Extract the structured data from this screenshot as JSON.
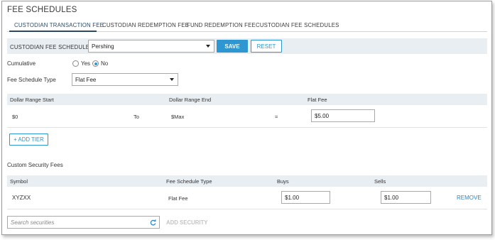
{
  "page": {
    "title": "FEE SCHEDULES"
  },
  "tabs": [
    {
      "label": "CUSTODIAN TRANSACTION FEE",
      "active": true
    },
    {
      "label": "CUSTODIAN REDEMPTION FEE",
      "active": false
    },
    {
      "label": "FUND REDEMPTION FEE",
      "active": false
    },
    {
      "label": "CUSTODIAN FEE SCHEDULES",
      "active": false
    }
  ],
  "schedule_bar": {
    "label": "CUSTODIAN FEE SCHEDULE",
    "selected": "Pershing",
    "save_label": "SAVE",
    "reset_label": "RESET"
  },
  "cumulative": {
    "label": "Cumulative",
    "options": [
      {
        "label": "Yes",
        "checked": false
      },
      {
        "label": "No",
        "checked": true
      }
    ]
  },
  "fee_schedule_type": {
    "label": "Fee Schedule Type",
    "selected": "Flat Fee"
  },
  "tiers": {
    "headers": {
      "start": "Dollar Range Start",
      "end": "Dollar Range End",
      "fee": "Flat Fee"
    },
    "rows": [
      {
        "start": "$0",
        "to": "To",
        "end": "$Max",
        "eq": "=",
        "fee": "$5.00"
      }
    ],
    "add_label": "+ ADD TIER"
  },
  "custom_fees": {
    "title": "Custom Security Fees",
    "headers": {
      "symbol": "Symbol",
      "type": "Fee Schedule Type",
      "buys": "Buys",
      "sells": "Sells"
    },
    "rows": [
      {
        "symbol": "XYZXX",
        "type": "Flat Fee",
        "buys": "$1.00",
        "sells": "$1.00",
        "remove_label": "REMOVE"
      }
    ],
    "search_placeholder": "Search securities",
    "add_security_label": "ADD SECURITY"
  },
  "colors": {
    "accent": "#2e96d1",
    "header_bg": "#e9eef3",
    "active_tab": "#2e4a63",
    "disabled": "#c4c4c4"
  },
  "icons": {
    "select_caret": "caret-down-icon",
    "search_refresh": "refresh-icon"
  }
}
